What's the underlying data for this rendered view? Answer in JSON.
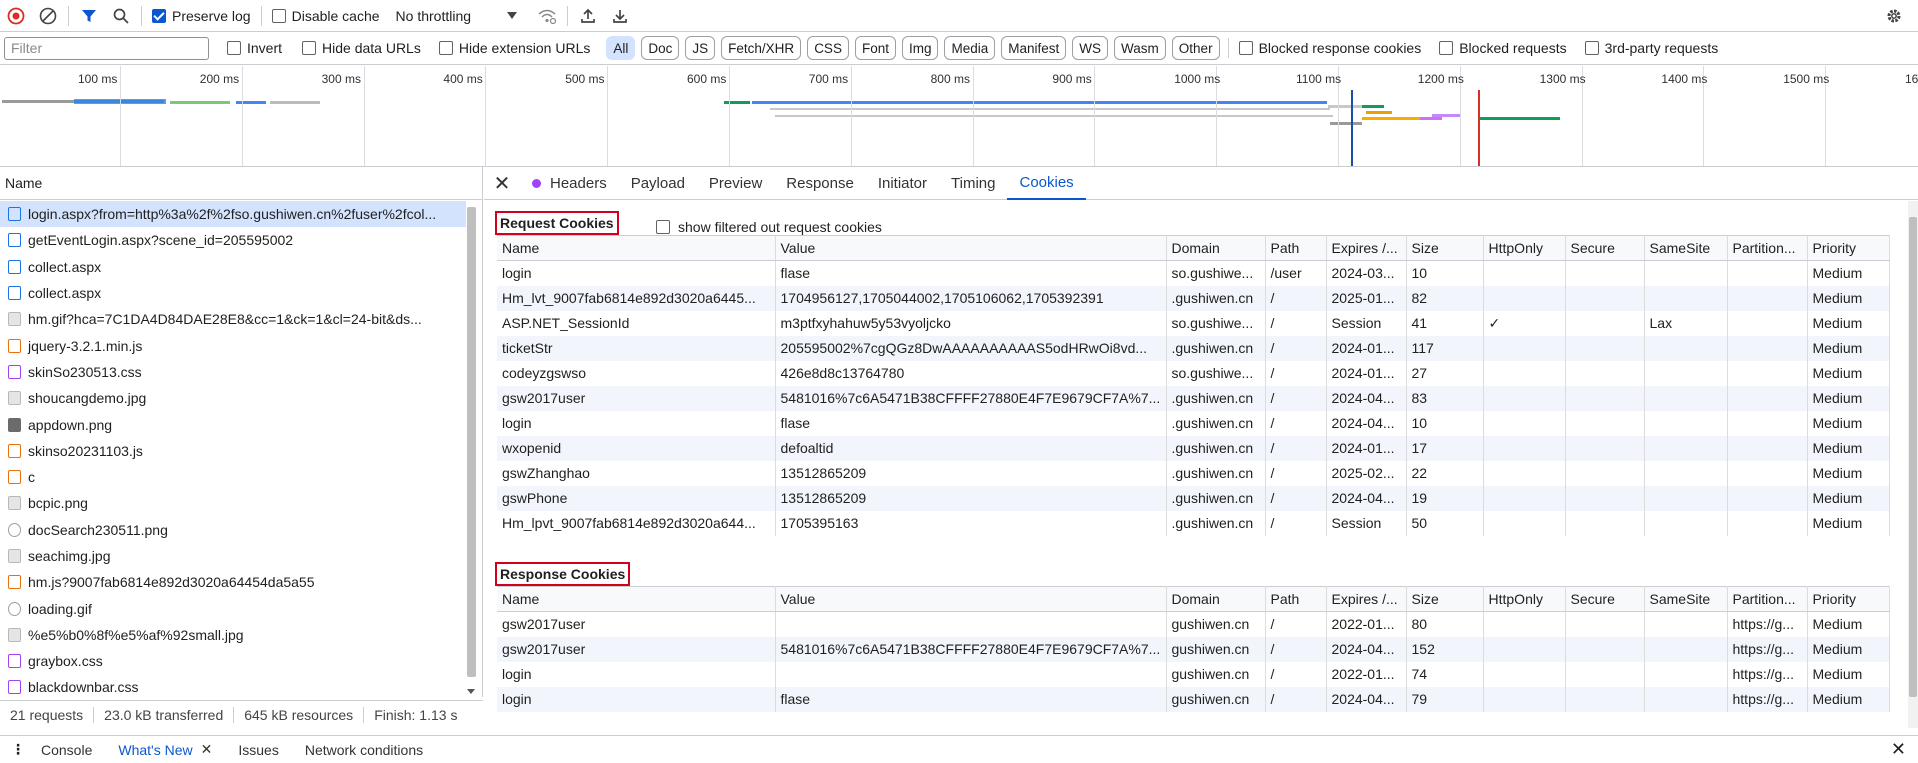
{
  "toolbar": {
    "preserve_log_label": "Preserve log",
    "disable_cache_label": "Disable cache",
    "throttling_value": "No throttling"
  },
  "filterbar": {
    "filter_placeholder": "Filter",
    "invert_label": "Invert",
    "hide_data_urls_label": "Hide data URLs",
    "hide_extension_urls_label": "Hide extension URLs",
    "type_filters": [
      "All",
      "Doc",
      "JS",
      "Fetch/XHR",
      "CSS",
      "Font",
      "Img",
      "Media",
      "Manifest",
      "WS",
      "Wasm",
      "Other"
    ],
    "blocked_response_cookies_label": "Blocked response cookies",
    "blocked_requests_label": "Blocked requests",
    "third_party_label": "3rd-party requests"
  },
  "overview": {
    "ticks": [
      "100 ms",
      "200 ms",
      "300 ms",
      "400 ms",
      "500 ms",
      "600 ms",
      "700 ms",
      "800 ms",
      "900 ms",
      "1000 ms",
      "1100 ms",
      "1200 ms",
      "1300 ms",
      "1400 ms",
      "1500 ms",
      "160"
    ]
  },
  "requests": {
    "header": "Name",
    "items": [
      {
        "name": "login.aspx?from=http%3a%2f%2fso.gushiwen.cn%2fuser%2fcol...",
        "type": "doc"
      },
      {
        "name": "getEventLogin.aspx?scene_id=205595002",
        "type": "doc"
      },
      {
        "name": "collect.aspx",
        "type": "doc"
      },
      {
        "name": "collect.aspx",
        "type": "doc"
      },
      {
        "name": "hm.gif?hca=7C1DA4D84DAE28E8&cc=1&ck=1&cl=24-bit&ds...",
        "type": "img"
      },
      {
        "name": "jquery-3.2.1.min.js",
        "type": "script"
      },
      {
        "name": "skinSo230513.css",
        "type": "css"
      },
      {
        "name": "shoucangdemo.jpg",
        "type": "img"
      },
      {
        "name": "appdown.png",
        "type": "other"
      },
      {
        "name": "skinso20231103.js",
        "type": "script"
      },
      {
        "name": "c",
        "type": "script"
      },
      {
        "name": "bcpic.png",
        "type": "img"
      },
      {
        "name": "docSearch230511.png",
        "type": "font"
      },
      {
        "name": "seachimg.jpg",
        "type": "img"
      },
      {
        "name": "hm.js?9007fab6814e892d3020a64454da5a55",
        "type": "script"
      },
      {
        "name": "loading.gif",
        "type": "font"
      },
      {
        "name": "%e5%b0%8f%e5%af%92small.jpg",
        "type": "img"
      },
      {
        "name": "graybox.css",
        "type": "css"
      },
      {
        "name": "blackdownbar.css",
        "type": "css"
      }
    ]
  },
  "status": {
    "requests": "21 requests",
    "transferred": "23.0 kB transferred",
    "resources": "645 kB resources",
    "finish": "Finish: 1.13 s"
  },
  "detail": {
    "tabs": [
      "Headers",
      "Payload",
      "Preview",
      "Response",
      "Initiator",
      "Timing",
      "Cookies"
    ],
    "active_tab": "Cookies"
  },
  "cookies": {
    "columns": [
      "Name",
      "Value",
      "Domain",
      "Path",
      "Expires /...",
      "Size",
      "HttpOnly",
      "Secure",
      "SameSite",
      "Partition...",
      "Priority"
    ],
    "request_title": "Request Cookies",
    "show_filtered_label": "show filtered out request cookies",
    "request_rows": [
      [
        "login",
        "flase",
        "so.gushiwe...",
        "/user",
        "2024-03...",
        "10",
        "",
        "",
        "",
        "",
        "Medium"
      ],
      [
        "Hm_lvt_9007fab6814e892d3020a6445...",
        "1704956127,1705044002,1705106062,1705392391",
        ".gushiwen.cn",
        "/",
        "2025-01...",
        "82",
        "",
        "",
        "",
        "",
        "Medium"
      ],
      [
        "ASP.NET_SessionId",
        "m3ptfxyhahuw5y53vyoljcko",
        "so.gushiwe...",
        "/",
        "Session",
        "41",
        "✓",
        "",
        "Lax",
        "",
        "Medium"
      ],
      [
        "ticketStr",
        "205595002%7cgQGz8DwAAAAAAAAAAS5odHRwOi8vd...",
        ".gushiwen.cn",
        "/",
        "2024-01...",
        "117",
        "",
        "",
        "",
        "",
        "Medium"
      ],
      [
        "codeyzgswso",
        "426e8d8c13764780",
        "so.gushiwe...",
        "/",
        "2024-01...",
        "27",
        "",
        "",
        "",
        "",
        "Medium"
      ],
      [
        "gsw2017user",
        "5481016%7c6A5471B38CFFFF27880E4F7E9679CF7A%7...",
        ".gushiwen.cn",
        "/",
        "2024-04...",
        "83",
        "",
        "",
        "",
        "",
        "Medium"
      ],
      [
        "login",
        "flase",
        ".gushiwen.cn",
        "/",
        "2024-04...",
        "10",
        "",
        "",
        "",
        "",
        "Medium"
      ],
      [
        "wxopenid",
        "defoaltid",
        ".gushiwen.cn",
        "/",
        "2024-01...",
        "17",
        "",
        "",
        "",
        "",
        "Medium"
      ],
      [
        "gswZhanghao",
        "13512865209",
        ".gushiwen.cn",
        "/",
        "2025-02...",
        "22",
        "",
        "",
        "",
        "",
        "Medium"
      ],
      [
        "gswPhone",
        "13512865209",
        ".gushiwen.cn",
        "/",
        "2024-04...",
        "19",
        "",
        "",
        "",
        "",
        "Medium"
      ],
      [
        "Hm_lpvt_9007fab6814e892d3020a644...",
        "1705395163",
        ".gushiwen.cn",
        "/",
        "Session",
        "50",
        "",
        "",
        "",
        "",
        "Medium"
      ]
    ],
    "response_title": "Response Cookies",
    "response_rows": [
      [
        "gsw2017user",
        "",
        "gushiwen.cn",
        "/",
        "2022-01...",
        "80",
        "",
        "",
        "",
        "https://g...",
        "Medium"
      ],
      [
        "gsw2017user",
        "5481016%7c6A5471B38CFFFF27880E4F7E9679CF7A%7...",
        "gushiwen.cn",
        "/",
        "2024-04...",
        "152",
        "",
        "",
        "",
        "https://g...",
        "Medium"
      ],
      [
        "login",
        "",
        "gushiwen.cn",
        "/",
        "2022-01...",
        "74",
        "",
        "",
        "",
        "https://g...",
        "Medium"
      ],
      [
        "login",
        "flase",
        "gushiwen.cn",
        "/",
        "2024-04...",
        "79",
        "",
        "",
        "",
        "https://g...",
        "Medium"
      ]
    ]
  },
  "drawer": {
    "tabs": [
      "Console",
      "What's New",
      "Issues",
      "Network conditions"
    ],
    "active_tab": "What's New"
  },
  "colors": {
    "accent": "#0b57d0",
    "highlight_box": "#d0021b",
    "selected_row": "#d3e3fd"
  }
}
